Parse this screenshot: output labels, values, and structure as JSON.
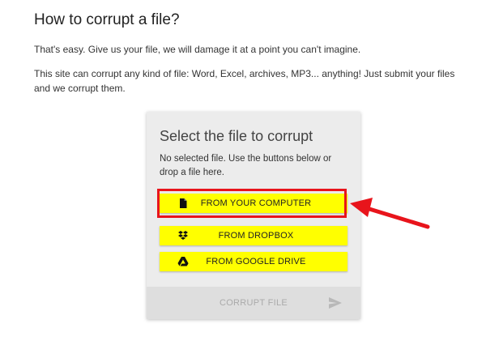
{
  "page": {
    "heading": "How to corrupt a file?",
    "intro": "That's easy. Give us your file, we will damage it at a point you can't imagine.",
    "description": "This site can corrupt any kind of file: Word, Excel, archives, MP3... anything! Just submit your files and we corrupt them."
  },
  "card": {
    "title": "Select the file to corrupt",
    "status": "No selected file. Use the buttons below or drop a file here.",
    "buttons": [
      {
        "label": "FROM YOUR COMPUTER",
        "icon": "file-icon"
      },
      {
        "label": "FROM DROPBOX",
        "icon": "dropbox-icon"
      },
      {
        "label": "FROM GOOGLE DRIVE",
        "icon": "google-drive-icon"
      }
    ],
    "submit_label": "CORRUPT FILE",
    "submit_icon": "send-icon"
  },
  "colors": {
    "button_bg": "#ffff00",
    "highlight": "#e8141b",
    "card_bg": "#ececec"
  }
}
